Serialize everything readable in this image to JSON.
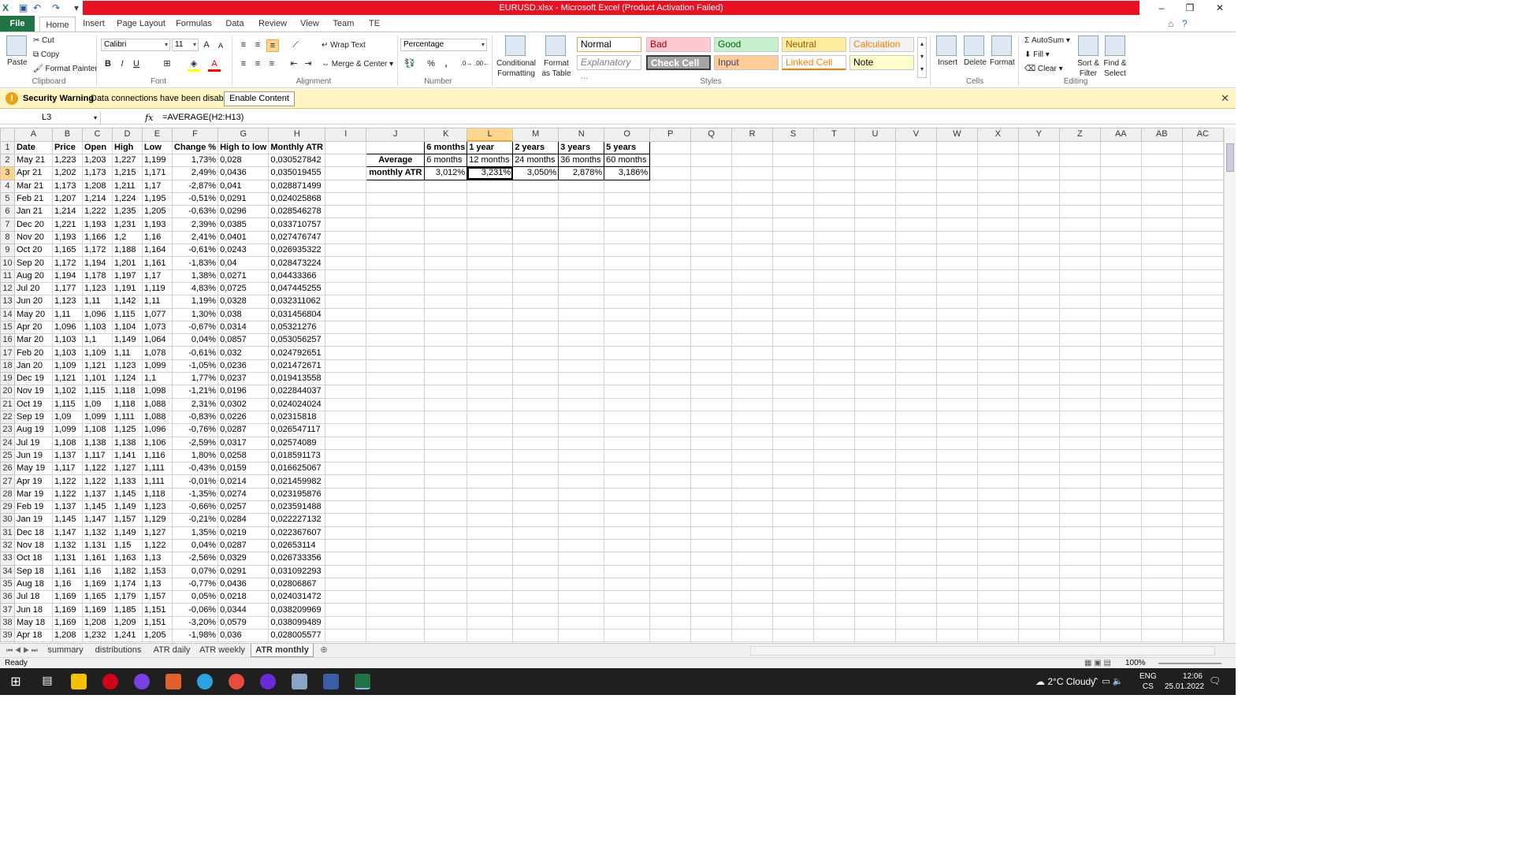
{
  "window": {
    "title": "EURUSD.xlsx - Microsoft Excel (Product Activation Failed)"
  },
  "tabs": [
    "File",
    "Home",
    "Insert",
    "Page Layout",
    "Formulas",
    "Data",
    "Review",
    "View",
    "Team",
    "TE"
  ],
  "ribbon": {
    "clipboard": {
      "paste": "Paste",
      "cut": "Cut",
      "copy": "Copy",
      "format_painter": "Format Painter",
      "label": "Clipboard"
    },
    "font": {
      "name": "Calibri",
      "size": "11",
      "bold": "B",
      "italic": "I",
      "underline": "U",
      "label": "Font"
    },
    "alignment": {
      "wrap": "Wrap Text",
      "merge": "Merge & Center",
      "label": "Alignment"
    },
    "number": {
      "format": "Percentage",
      "percent": "%",
      "comma": ",",
      "label": "Number"
    },
    "styles": {
      "conditional": "Conditional Formatting",
      "format_table": "Format as Table",
      "cells": [
        {
          "name": "Normal",
          "bg": "#ffffff",
          "fg": "#000000"
        },
        {
          "name": "Bad",
          "bg": "#ffc7ce",
          "fg": "#9c0006"
        },
        {
          "name": "Good",
          "bg": "#c6efce",
          "fg": "#006100"
        },
        {
          "name": "Neutral",
          "bg": "#ffeb9c",
          "fg": "#9c5700"
        },
        {
          "name": "Calculation",
          "bg": "#f2f2f2",
          "fg": "#fa7d00"
        },
        {
          "name": "Explanatory ...",
          "bg": "#ffffff",
          "fg": "#7f7f7f"
        },
        {
          "name": "Check Cell",
          "bg": "#a5a5a5",
          "fg": "#ffffff"
        },
        {
          "name": "Input",
          "bg": "#ffcc99",
          "fg": "#3f3f76"
        },
        {
          "name": "Linked Cell",
          "bg": "#ffffff",
          "fg": "#fa7d00"
        },
        {
          "name": "Note",
          "bg": "#ffffcc",
          "fg": "#000000"
        }
      ],
      "label": "Styles"
    },
    "cells": {
      "insert": "Insert",
      "delete": "Delete",
      "format": "Format",
      "label": "Cells"
    },
    "editing": {
      "autosum": "AutoSum",
      "fill": "Fill",
      "clear": "Clear",
      "sort": "Sort & Filter",
      "find": "Find & Select",
      "label": "Editing"
    }
  },
  "security": {
    "title": "Security Warning",
    "message": "Data connections have been disabled",
    "button": "Enable Content"
  },
  "formula_bar": {
    "cell": "L3",
    "fx": "fx",
    "formula": "=AVERAGE(H2:H13)"
  },
  "columns": [
    "A",
    "B",
    "C",
    "D",
    "E",
    "F",
    "G",
    "H",
    "I",
    "J",
    "K",
    "L",
    "M",
    "N",
    "O",
    "P",
    "Q",
    "R",
    "S",
    "T",
    "U",
    "V",
    "W",
    "X",
    "Y",
    "Z",
    "AA",
    "AB",
    "AC"
  ],
  "headers": [
    "Date",
    "Price",
    "Open",
    "High",
    "Low",
    "Change %",
    "High to low",
    "Monthly ATR"
  ],
  "rows": [
    [
      "May 21",
      "1,223",
      "1,203",
      "1,227",
      "1,199",
      "1,73%",
      "0,028",
      "0,030527842"
    ],
    [
      "Apr 21",
      "1,202",
      "1,173",
      "1,215",
      "1,171",
      "2,49%",
      "0,0436",
      "0,035019455"
    ],
    [
      "Mar 21",
      "1,173",
      "1,208",
      "1,211",
      "1,17",
      "-2,87%",
      "0,041",
      "0,028871499"
    ],
    [
      "Feb 21",
      "1,207",
      "1,214",
      "1,224",
      "1,195",
      "-0,51%",
      "0,0291",
      "0,024025868"
    ],
    [
      "Jan 21",
      "1,214",
      "1,222",
      "1,235",
      "1,205",
      "-0,63%",
      "0,0296",
      "0,028546278"
    ],
    [
      "Dec 20",
      "1,221",
      "1,193",
      "1,231",
      "1,193",
      "2,39%",
      "0,0385",
      "0,033710757"
    ],
    [
      "Nov 20",
      "1,193",
      "1,166",
      "1,2",
      "1,16",
      "2,41%",
      "0,0401",
      "0,027476747"
    ],
    [
      "Oct 20",
      "1,165",
      "1,172",
      "1,188",
      "1,164",
      "-0,61%",
      "0,0243",
      "0,026935322"
    ],
    [
      "Sep 20",
      "1,172",
      "1,194",
      "1,201",
      "1,161",
      "-1,83%",
      "0,04",
      "0,028473224"
    ],
    [
      "Aug 20",
      "1,194",
      "1,178",
      "1,197",
      "1,17",
      "1,38%",
      "0,0271",
      "0,04433366"
    ],
    [
      "Jul 20",
      "1,177",
      "1,123",
      "1,191",
      "1,119",
      "4,83%",
      "0,0725",
      "0,047445255"
    ],
    [
      "Jun 20",
      "1,123",
      "1,11",
      "1,142",
      "1,11",
      "1,19%",
      "0,0328",
      "0,032311062"
    ],
    [
      "May 20",
      "1,11",
      "1,096",
      "1,115",
      "1,077",
      "1,30%",
      "0,038",
      "0,031456804"
    ],
    [
      "Apr 20",
      "1,096",
      "1,103",
      "1,104",
      "1,073",
      "-0,67%",
      "0,0314",
      "0,05321276"
    ],
    [
      "Mar 20",
      "1,103",
      "1,1",
      "1,149",
      "1,064",
      "0,04%",
      "0,0857",
      "0,053056257"
    ],
    [
      "Feb 20",
      "1,103",
      "1,109",
      "1,11",
      "1,078",
      "-0,61%",
      "0,032",
      "0,024792651"
    ],
    [
      "Jan 20",
      "1,109",
      "1,121",
      "1,123",
      "1,099",
      "-1,05%",
      "0,0236",
      "0,021472671"
    ],
    [
      "Dec 19",
      "1,121",
      "1,101",
      "1,124",
      "1,1",
      "1,77%",
      "0,0237",
      "0,019413558"
    ],
    [
      "Nov 19",
      "1,102",
      "1,115",
      "1,118",
      "1,098",
      "-1,21%",
      "0,0196",
      "0,022844037"
    ],
    [
      "Oct 19",
      "1,115",
      "1,09",
      "1,118",
      "1,088",
      "2,31%",
      "0,0302",
      "0,024024024"
    ],
    [
      "Sep 19",
      "1,09",
      "1,099",
      "1,111",
      "1,088",
      "-0,83%",
      "0,0226",
      "0,02315818"
    ],
    [
      "Aug 19",
      "1,099",
      "1,108",
      "1,125",
      "1,096",
      "-0,76%",
      "0,0287",
      "0,026547117"
    ],
    [
      "Jul 19",
      "1,108",
      "1,138",
      "1,138",
      "1,106",
      "-2,59%",
      "0,0317",
      "0,02574089"
    ],
    [
      "Jun 19",
      "1,137",
      "1,117",
      "1,141",
      "1,116",
      "1,80%",
      "0,0258",
      "0,018591173"
    ],
    [
      "May 19",
      "1,117",
      "1,122",
      "1,127",
      "1,111",
      "-0,43%",
      "0,0159",
      "0,016625067"
    ],
    [
      "Apr 19",
      "1,122",
      "1,122",
      "1,133",
      "1,111",
      "-0,01%",
      "0,0214",
      "0,021459982"
    ],
    [
      "Mar 19",
      "1,122",
      "1,137",
      "1,145",
      "1,118",
      "-1,35%",
      "0,0274",
      "0,023195876"
    ],
    [
      "Feb 19",
      "1,137",
      "1,145",
      "1,149",
      "1,123",
      "-0,66%",
      "0,0257",
      "0,023591488"
    ],
    [
      "Jan 19",
      "1,145",
      "1,147",
      "1,157",
      "1,129",
      "-0,21%",
      "0,0284",
      "0,022227132"
    ],
    [
      "Dec 18",
      "1,147",
      "1,132",
      "1,149",
      "1,127",
      "1,35%",
      "0,0219",
      "0,022367607"
    ],
    [
      "Nov 18",
      "1,132",
      "1,131",
      "1,15",
      "1,122",
      "0,04%",
      "0,0287",
      "0,02653114"
    ],
    [
      "Oct 18",
      "1,131",
      "1,161",
      "1,163",
      "1,13",
      "-2,56%",
      "0,0329",
      "0,026733356"
    ],
    [
      "Sep 18",
      "1,161",
      "1,16",
      "1,182",
      "1,153",
      "0,07%",
      "0,0291",
      "0,031092293"
    ],
    [
      "Aug 18",
      "1,16",
      "1,169",
      "1,174",
      "1,13",
      "-0,77%",
      "0,0436",
      "0,02806867"
    ],
    [
      "Jul 18",
      "1,169",
      "1,165",
      "1,179",
      "1,157",
      "0,05%",
      "0,0218",
      "0,024031472"
    ],
    [
      "Jun 18",
      "1,169",
      "1,169",
      "1,185",
      "1,151",
      "-0,06%",
      "0,0344",
      "0,038209969"
    ],
    [
      "May 18",
      "1,169",
      "1,208",
      "1,209",
      "1,151",
      "-3,20%",
      "0,0579",
      "0,038099489"
    ],
    [
      "Apr 18",
      "1,208",
      "1,232",
      "1,241",
      "1,205",
      "-1,98%",
      "0,036",
      "0,028005577"
    ]
  ],
  "summary": {
    "row1": [
      "6 months",
      "1 year",
      "2 years",
      "3 years",
      "5 years"
    ],
    "row2_label": "Average",
    "row2": [
      "6 months",
      "12 months",
      "24 months",
      "36 months",
      "60 months"
    ],
    "row3_label": "monthly ATR",
    "row3": [
      "3,012%",
      "3,231%",
      "3,050%",
      "2,878%",
      "3,186%"
    ]
  },
  "sheets": [
    "summary",
    "distributions",
    "ATR daily",
    "ATR weekly",
    "ATR monthly"
  ],
  "status": {
    "ready": "Ready",
    "zoom": "100%"
  },
  "taskbar": {
    "weather": "2°C  Cloudy",
    "lang1": "ENG",
    "lang2": "CS",
    "time": "12:06",
    "date": "25.01.2022"
  }
}
